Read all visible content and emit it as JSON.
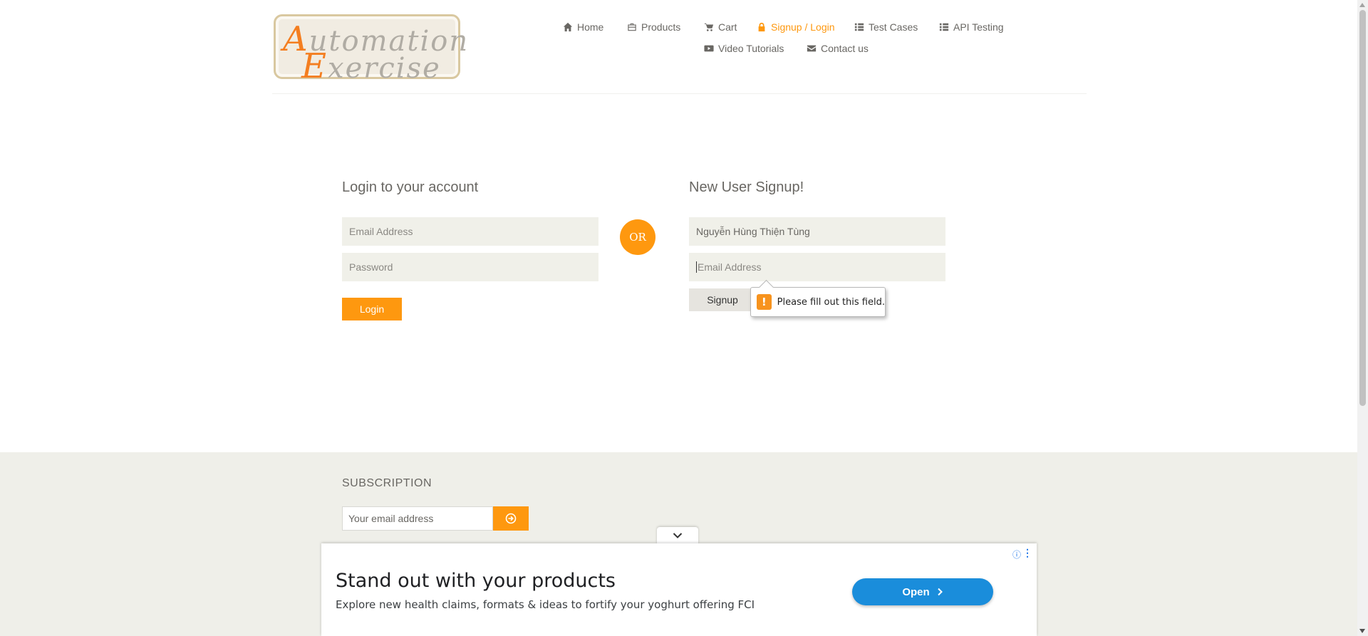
{
  "logo": {
    "line1_cap": "A",
    "line1_rest": "utomation",
    "line2_cap": "E",
    "line2_rest": "xercise"
  },
  "nav": {
    "items": [
      {
        "label": "Home",
        "icon": "home-icon"
      },
      {
        "label": "Products",
        "icon": "briefcase-icon"
      },
      {
        "label": "Cart",
        "icon": "cart-icon"
      },
      {
        "label": "Signup / Login",
        "icon": "lock-icon",
        "active": true
      },
      {
        "label": "Test Cases",
        "icon": "list-icon"
      },
      {
        "label": "API Testing",
        "icon": "list-icon"
      },
      {
        "label": "Video Tutorials",
        "icon": "youtube-play-icon"
      },
      {
        "label": "Contact us",
        "icon": "envelope-icon"
      }
    ]
  },
  "login": {
    "title": "Login to your account",
    "email_placeholder": "Email Address",
    "password_placeholder": "Password",
    "button": "Login"
  },
  "or_label": "OR",
  "signup": {
    "title": "New User Signup!",
    "name_value": "Nguyễn Hùng Thiện Tùng",
    "email_placeholder": "Email Address",
    "button": "Signup",
    "validation_message": "Please fill out this field."
  },
  "footer": {
    "subscription_title": "SUBSCRIPTION",
    "email_placeholder": "Your email address"
  },
  "ad": {
    "headline": "Stand out with your products",
    "description": "Explore new health claims, formats & ideas to fortify your yoghurt offering FCI",
    "cta": "Open",
    "info_icon": "ⓘ",
    "menu_icon": "⋮"
  },
  "colors": {
    "accent": "#fe980f",
    "text": "#696763",
    "field_bg": "#f0f0e9",
    "footer_bg": "#efefe9",
    "ad_button": "#1a8ddb"
  }
}
